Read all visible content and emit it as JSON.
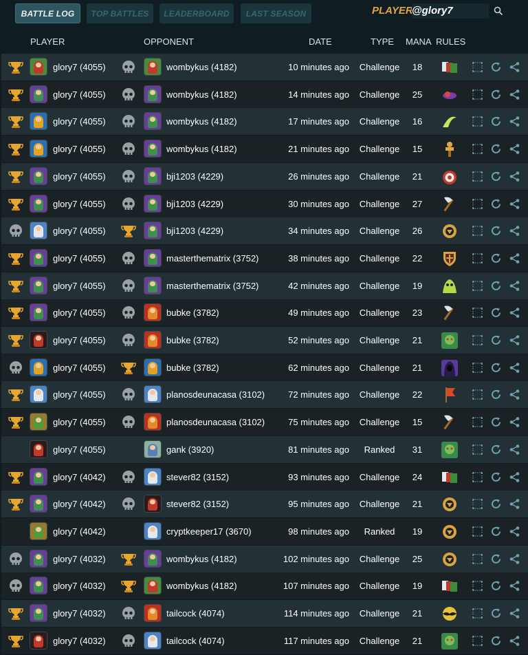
{
  "tabs": [
    {
      "label": "BATTLE LOG",
      "active": true
    },
    {
      "label": "TOP BATTLES",
      "active": false
    },
    {
      "label": "LEADERBOARD",
      "active": false
    },
    {
      "label": "LAST SEASON",
      "active": false
    }
  ],
  "search": {
    "label": "PLAYER:",
    "value": "@glory7"
  },
  "columns": {
    "player": "PLAYER",
    "opponent": "OPPONENT",
    "date": "DATE",
    "type": "TYPE",
    "mana": "MANA",
    "rules": "RULES"
  },
  "colors": {
    "accent": "#e0a744",
    "row_even": "#233035",
    "row_odd": "#1a2226",
    "action_icon": "#6fa3b2"
  },
  "rows": [
    {
      "player_result": "win",
      "player": "glory7 (4055)",
      "player_avatar": "green-hero",
      "opponent_result": "loss",
      "opponent": "wombykus (4182)",
      "opponent_avatar": "green-hero",
      "date": "10 minutes ago",
      "type": "Challenge",
      "mana": "18",
      "rule": "rule-cards-icon"
    },
    {
      "player_result": "win",
      "player": "glory7 (4055)",
      "player_avatar": "purple-dragon",
      "opponent_result": "loss",
      "opponent": "wombykus (4182)",
      "opponent_avatar": "purple-dragon",
      "date": "14 minutes ago",
      "type": "Challenge",
      "mana": "25",
      "rule": "rule-snail-icon"
    },
    {
      "player_result": "win",
      "player": "glory7 (4055)",
      "player_avatar": "blue-wizard",
      "opponent_result": "loss",
      "opponent": "wombykus (4182)",
      "opponent_avatar": "purple-dragon",
      "date": "17 minutes ago",
      "type": "Challenge",
      "mana": "16",
      "rule": "rule-whirl-icon"
    },
    {
      "player_result": "win",
      "player": "glory7 (4055)",
      "player_avatar": "blue-wizard",
      "opponent_result": "loss",
      "opponent": "wombykus (4182)",
      "opponent_avatar": "purple-dragon",
      "date": "21 minutes ago",
      "type": "Challenge",
      "mana": "15",
      "rule": "rule-dummy-icon"
    },
    {
      "player_result": "win",
      "player": "glory7 (4055)",
      "player_avatar": "purple-dragon",
      "opponent_result": "loss",
      "opponent": "bji1203 (4229)",
      "opponent_avatar": "purple-dragon",
      "date": "26 minutes ago",
      "type": "Challenge",
      "mana": "21",
      "rule": "rule-target-icon"
    },
    {
      "player_result": "win",
      "player": "glory7 (4055)",
      "player_avatar": "purple-dragon",
      "opponent_result": "loss",
      "opponent": "bji1203 (4229)",
      "opponent_avatar": "purple-dragon",
      "date": "30 minutes ago",
      "type": "Challenge",
      "mana": "27",
      "rule": "rule-axe-icon"
    },
    {
      "player_result": "loss",
      "player": "glory7 (4055)",
      "player_avatar": "white-wizard",
      "opponent_result": "win",
      "opponent": "bji1203 (4229)",
      "opponent_avatar": "purple-dragon",
      "date": "34 minutes ago",
      "type": "Challenge",
      "mana": "26",
      "rule": "rule-coin-icon"
    },
    {
      "player_result": "win",
      "player": "glory7 (4055)",
      "player_avatar": "purple-dragon",
      "opponent_result": "loss",
      "opponent": "masterthematrix (3752)",
      "opponent_avatar": "purple-dragon",
      "date": "38 minutes ago",
      "type": "Challenge",
      "mana": "22",
      "rule": "rule-shield-icon"
    },
    {
      "player_result": "win",
      "player": "glory7 (4055)",
      "player_avatar": "purple-dragon",
      "opponent_result": "loss",
      "opponent": "masterthematrix (3752)",
      "opponent_avatar": "purple-dragon",
      "date": "42 minutes ago",
      "type": "Challenge",
      "mana": "19",
      "rule": "rule-slime-icon"
    },
    {
      "player_result": "win",
      "player": "glory7 (4055)",
      "player_avatar": "purple-dragon",
      "opponent_result": "loss",
      "opponent": "bubke (3782)",
      "opponent_avatar": "red-dragon",
      "date": "49 minutes ago",
      "type": "Challenge",
      "mana": "23",
      "rule": "rule-axe-icon"
    },
    {
      "player_result": "win",
      "player": "glory7 (4055)",
      "player_avatar": "dark-fiend",
      "opponent_result": "loss",
      "opponent": "bubke (3782)",
      "opponent_avatar": "red-dragon",
      "date": "52 minutes ago",
      "type": "Challenge",
      "mana": "21",
      "rule": "rule-goblin-icon"
    },
    {
      "player_result": "loss",
      "player": "glory7 (4055)",
      "player_avatar": "blue-wizard",
      "opponent_result": "win",
      "opponent": "bubke (3782)",
      "opponent_avatar": "blue-wizard",
      "date": "62 minutes ago",
      "type": "Challenge",
      "mana": "21",
      "rule": "rule-hood-icon"
    },
    {
      "player_result": "win",
      "player": "glory7 (4055)",
      "player_avatar": "white-wizard",
      "opponent_result": "loss",
      "opponent": "planosdeunacasa (3102)",
      "opponent_avatar": "white-wizard",
      "date": "72 minutes ago",
      "type": "Challenge",
      "mana": "22",
      "rule": "rule-banner-icon"
    },
    {
      "player_result": "win",
      "player": "glory7 (4055)",
      "player_avatar": "earth-golem",
      "opponent_result": "loss",
      "opponent": "planosdeunacasa (3102)",
      "opponent_avatar": "red-dragon",
      "date": "75 minutes ago",
      "type": "Challenge",
      "mana": "15",
      "rule": "rule-axe-icon"
    },
    {
      "player_result": "none",
      "player": "glory7 (4055)",
      "player_avatar": "dark-fiend",
      "opponent_result": "none",
      "opponent": "gank (3920)",
      "opponent_avatar": "elf-archer",
      "date": "81 minutes ago",
      "type": "Ranked",
      "mana": "31",
      "rule": "rule-goblin-icon"
    },
    {
      "player_result": "win",
      "player": "glory7 (4042)",
      "player_avatar": "purple-dragon",
      "opponent_result": "loss",
      "opponent": "stever82 (3152)",
      "opponent_avatar": "white-wizard",
      "date": "93 minutes ago",
      "type": "Challenge",
      "mana": "24",
      "rule": "rule-cards-icon"
    },
    {
      "player_result": "win",
      "player": "glory7 (4042)",
      "player_avatar": "purple-dragon",
      "opponent_result": "loss",
      "opponent": "stever82 (3152)",
      "opponent_avatar": "dark-fiend",
      "date": "95 minutes ago",
      "type": "Challenge",
      "mana": "21",
      "rule": "rule-coin-icon"
    },
    {
      "player_result": "none",
      "player": "glory7 (4042)",
      "player_avatar": "earth-golem",
      "opponent_result": "none",
      "opponent": "cryptkeeper17 (3670)",
      "opponent_avatar": "white-wizard",
      "date": "98 minutes ago",
      "type": "Ranked",
      "mana": "19",
      "rule": "rule-coin-icon"
    },
    {
      "player_result": "loss",
      "player": "glory7 (4032)",
      "player_avatar": "purple-dragon",
      "opponent_result": "win",
      "opponent": "wombykus (4182)",
      "opponent_avatar": "purple-dragon",
      "date": "102 minutes ago",
      "type": "Challenge",
      "mana": "25",
      "rule": "rule-coin-icon"
    },
    {
      "player_result": "loss",
      "player": "glory7 (4032)",
      "player_avatar": "purple-dragon",
      "opponent_result": "win",
      "opponent": "wombykus (4182)",
      "opponent_avatar": "green-hero",
      "date": "107 minutes ago",
      "type": "Challenge",
      "mana": "19",
      "rule": "rule-cards-icon"
    },
    {
      "player_result": "win",
      "player": "glory7 (4032)",
      "player_avatar": "purple-dragon",
      "opponent_result": "loss",
      "opponent": "tailcock (4074)",
      "opponent_avatar": "red-dragon",
      "date": "114 minutes ago",
      "type": "Challenge",
      "mana": "21",
      "rule": "rule-bat-icon"
    },
    {
      "player_result": "win",
      "player": "glory7 (4032)",
      "player_avatar": "dark-fiend",
      "opponent_result": "loss",
      "opponent": "tailcock (4074)",
      "opponent_avatar": "white-wizard",
      "date": "117 minutes ago",
      "type": "Challenge",
      "mana": "21",
      "rule": "rule-goblin-icon"
    }
  ]
}
